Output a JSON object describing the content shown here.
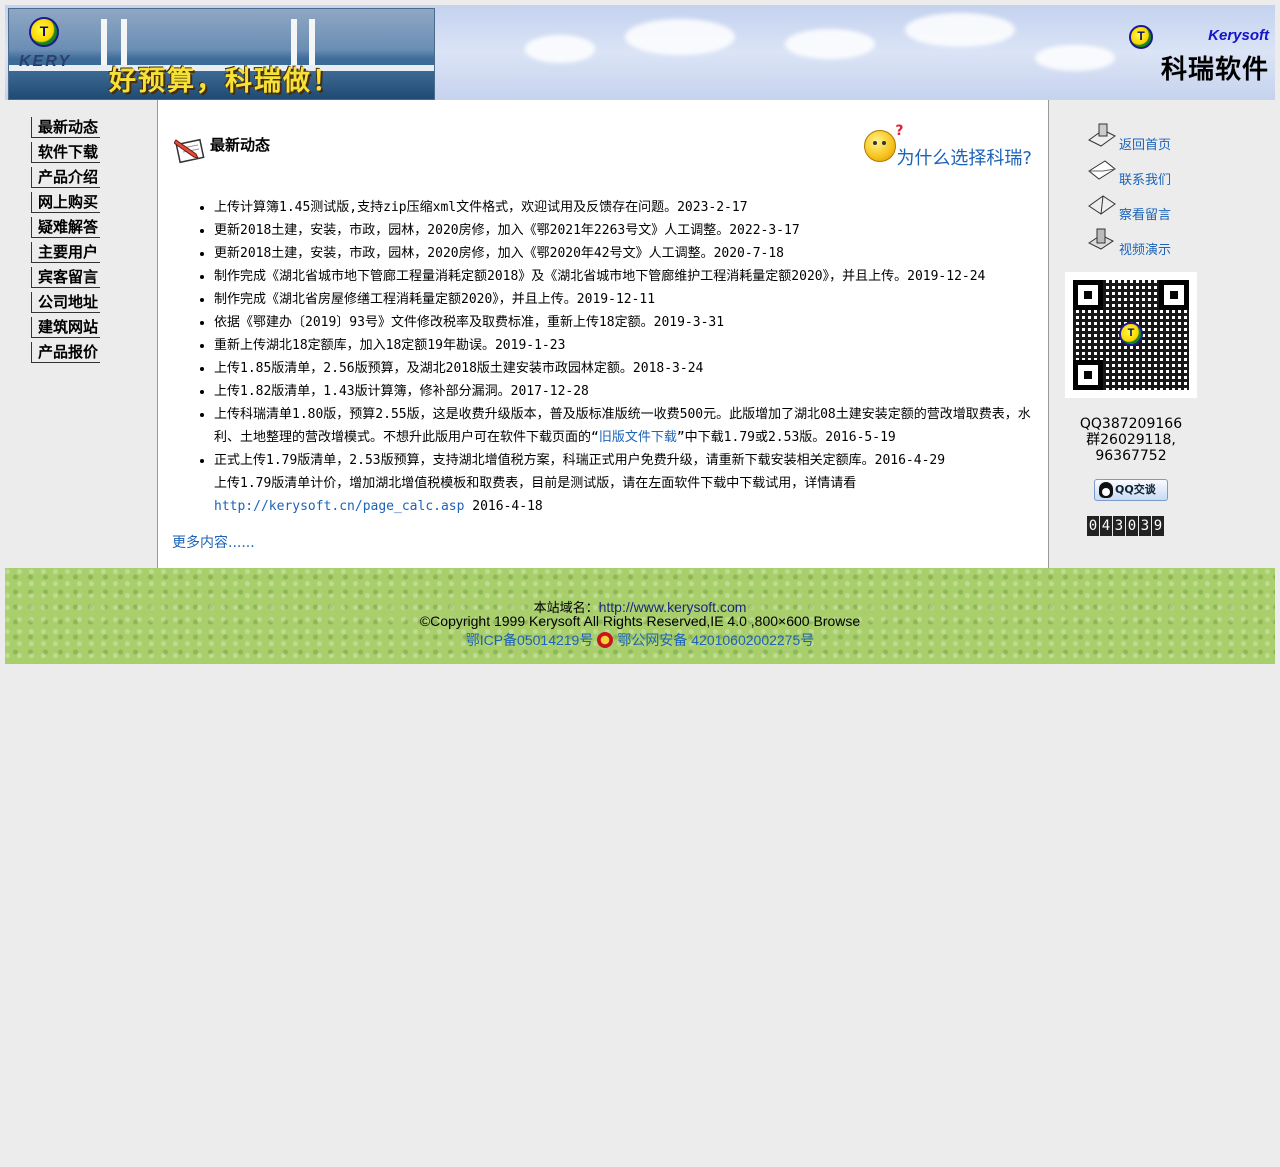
{
  "header": {
    "banner_logo_letter": "T",
    "banner_kery": "KERY",
    "slogan": "好预算，科瑞做！",
    "brand_logo_letter": "T",
    "brand_en": "Kerysoft",
    "brand_cn": "科瑞软件"
  },
  "left_nav": {
    "items": [
      {
        "label": "最新动态"
      },
      {
        "label": "软件下载"
      },
      {
        "label": "产品介绍"
      },
      {
        "label": "网上购买"
      },
      {
        "label": "疑难解答"
      },
      {
        "label": "主要用户"
      },
      {
        "label": "宾客留言"
      },
      {
        "label": "公司地址"
      },
      {
        "label": "建筑网站"
      },
      {
        "label": "产品报价"
      }
    ]
  },
  "main": {
    "title": "最新动态",
    "why_link": "为什么选择科瑞?",
    "news": [
      {
        "text": "上传计算簿1.45测试版,支持zip压缩xml文件格式，欢迎试用及反馈存在问题。2023-2-17"
      },
      {
        "text": "更新2018土建，安装，市政，园林，2020房修，加入《鄂2021年2263号文》人工调整。2022-3-17"
      },
      {
        "text": "更新2018土建，安装，市政，园林，2020房修，加入《鄂2020年42号文》人工调整。2020-7-18"
      },
      {
        "text": "制作完成《湖北省城市地下管廊工程量消耗定额2018》及《湖北省城市地下管廊维护工程消耗量定额2020》，并且上传。2019-12-24"
      },
      {
        "text": "制作完成《湖北省房屋修缮工程消耗量定额2020》，并且上传。2019-12-11"
      },
      {
        "text": "依据《鄂建办〔2019〕93号》文件修改税率及取费标准，重新上传18定额。2019-3-31"
      },
      {
        "text": "重新上传湖北18定额库，加入18定额19年勘误。2019-1-23"
      },
      {
        "text": "上传1.85版清单，2.56版预算，及湖北2018版土建安装市政园林定额。2018-3-24"
      },
      {
        "text": "上传1.82版清单，1.43版计算簿，修补部分漏洞。2017-12-28"
      }
    ],
    "news_long": {
      "before": "上传科瑞清单1.80版，预算2.55版，这是收费升级版本，普及版标准版统一收费500元。此版增加了湖北08土建安装定额的营改增取费表，水利、土地整理的营改增模式。不想升此版用户可在软件下载页面的“",
      "link": "旧版文件下载",
      "after": "”中下载1.79或2.53版。2016-5-19"
    },
    "news_last": "正式上传1.79版清单，2.53版预算，支持湖北增值税方案，科瑞正式用户免费升级，请重新下载安装相关定额库。2016-4-29",
    "news_extra": {
      "before": "上传1.79版清单计价，增加湖北增值税模板和取费表，目前是测试版，请在左面软件下载中下载试用，详情请看 ",
      "link": "http://kerysoft.cn/page_calc.asp",
      "after": " 2016-4-18"
    },
    "more": "更多内容......"
  },
  "right_nav": {
    "items": [
      {
        "label": "返回首页",
        "icon": "home-icon"
      },
      {
        "label": "联系我们",
        "icon": "mail-icon"
      },
      {
        "label": "察看留言",
        "icon": "guestbook-icon"
      },
      {
        "label": "视频演示",
        "icon": "video-icon"
      }
    ],
    "qq": "QQ387209166",
    "group1": "群26029118,",
    "group2": "96367752",
    "qq_button": "QQ交谈",
    "counter": [
      "0",
      "4",
      "3",
      "0",
      "3",
      "9"
    ]
  },
  "footer": {
    "domain_label": "本站域名：",
    "domain": "http://www.kerysoft.com",
    "copyright": "©Copyright 1999 Kerysoft All Rights Reserved,IE 4.0 ,800×600 Browse",
    "icp": "鄂ICP备05014219号",
    "police": "鄂公网安备 42010602002275号"
  },
  "colors": {
    "link": "#1c63b8",
    "footer_bg": "#a9cf6d",
    "page_bg": "#ececec"
  }
}
